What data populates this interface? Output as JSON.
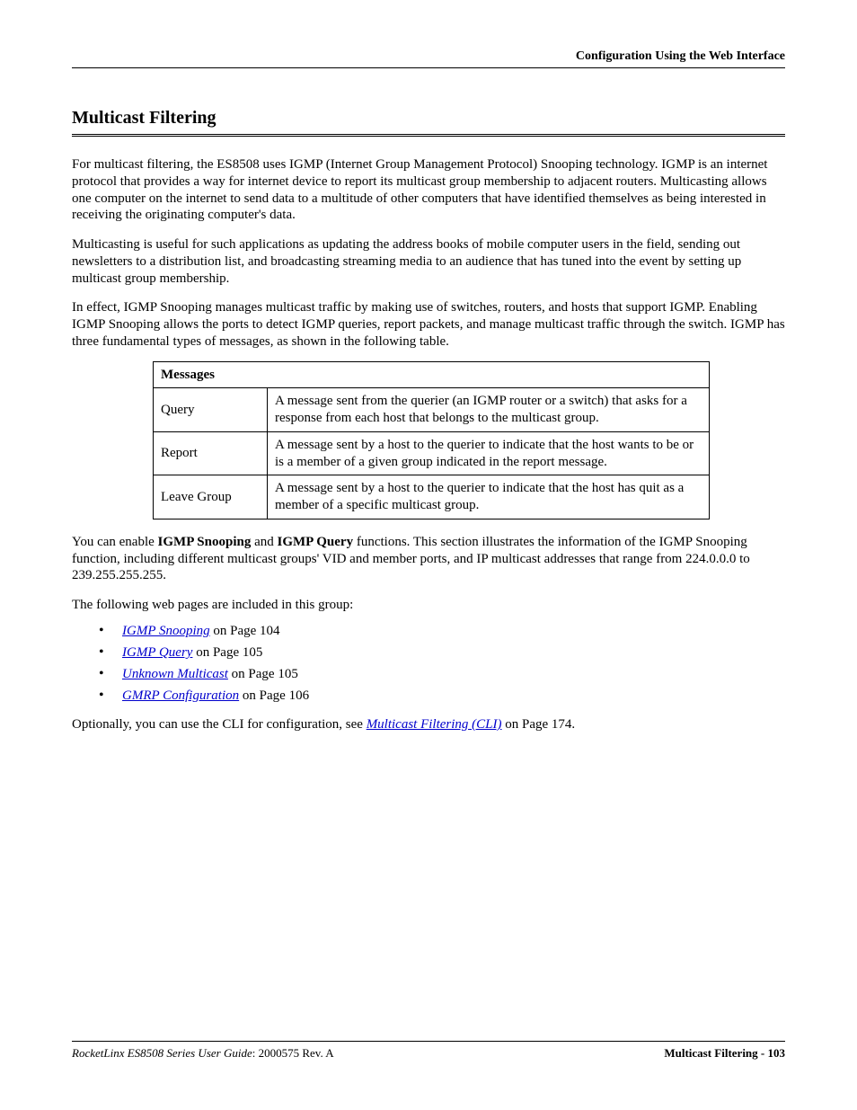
{
  "header": {
    "right": "Configuration Using the Web Interface"
  },
  "title": "Multicast Filtering",
  "para1": "For multicast filtering, the ES8508 uses IGMP (Internet Group Management Protocol) Snooping technology. IGMP is an internet protocol that provides a way for internet device to report its multicast group membership to adjacent routers. Multicasting allows one computer on the internet to send data to a multitude of other computers that have identified themselves as being interested in receiving the originating computer's data.",
  "para2": "Multicasting is useful for such applications as updating the address books of mobile computer users in the field, sending out newsletters to a distribution list, and broadcasting streaming media to an audience that has tuned into the event by setting up multicast group membership.",
  "para3": "In effect, IGMP Snooping manages multicast traffic by making use of switches, routers, and hosts that support IGMP. Enabling IGMP Snooping allows the ports to detect IGMP queries, report packets, and manage multicast traffic through the switch. IGMP has three fundamental types of messages, as shown in the following table.",
  "table": {
    "header": "Messages",
    "rows": [
      {
        "name": "Query",
        "desc": "A message sent from the querier (an IGMP router or a switch) that asks for a response from each host that belongs to the multicast group."
      },
      {
        "name": "Report",
        "desc": "A message sent by a host to the querier to indicate that the host wants to be or is a member of a given group indicated in the report message."
      },
      {
        "name": "Leave Group",
        "desc": "A message sent by a host to the querier to indicate that the host has quit as a member of a specific multicast group."
      }
    ]
  },
  "after_table": {
    "pre1": "You can enable ",
    "b1": "IGMP Snooping",
    "mid1": " and ",
    "b2": "IGMP Query",
    "post1": " functions. This section illustrates the information of the IGMP Snooping function, including different multicast groups' VID and member ports, and IP multicast addresses that range from 224.0.0.0 to 239.255.255.255."
  },
  "list_intro": "The following web pages are included in this group:",
  "links": [
    {
      "text": "IGMP Snooping",
      "suffix": " on Page 104"
    },
    {
      "text": "IGMP Query",
      "suffix": " on Page 105"
    },
    {
      "text": "Unknown Multicast",
      "suffix": " on Page 105"
    },
    {
      "text": "GMRP Configuration",
      "suffix": " on Page 106"
    }
  ],
  "cli": {
    "pre": "Optionally, you can use the CLI for configuration, see ",
    "link": "Multicast Filtering (CLI)",
    "post": " on Page 174."
  },
  "footer": {
    "left_italic": "RocketLinx ES8508 Series  User Guide",
    "left_rev": ": 2000575 Rev. A",
    "right": "Multicast Filtering - 103"
  }
}
